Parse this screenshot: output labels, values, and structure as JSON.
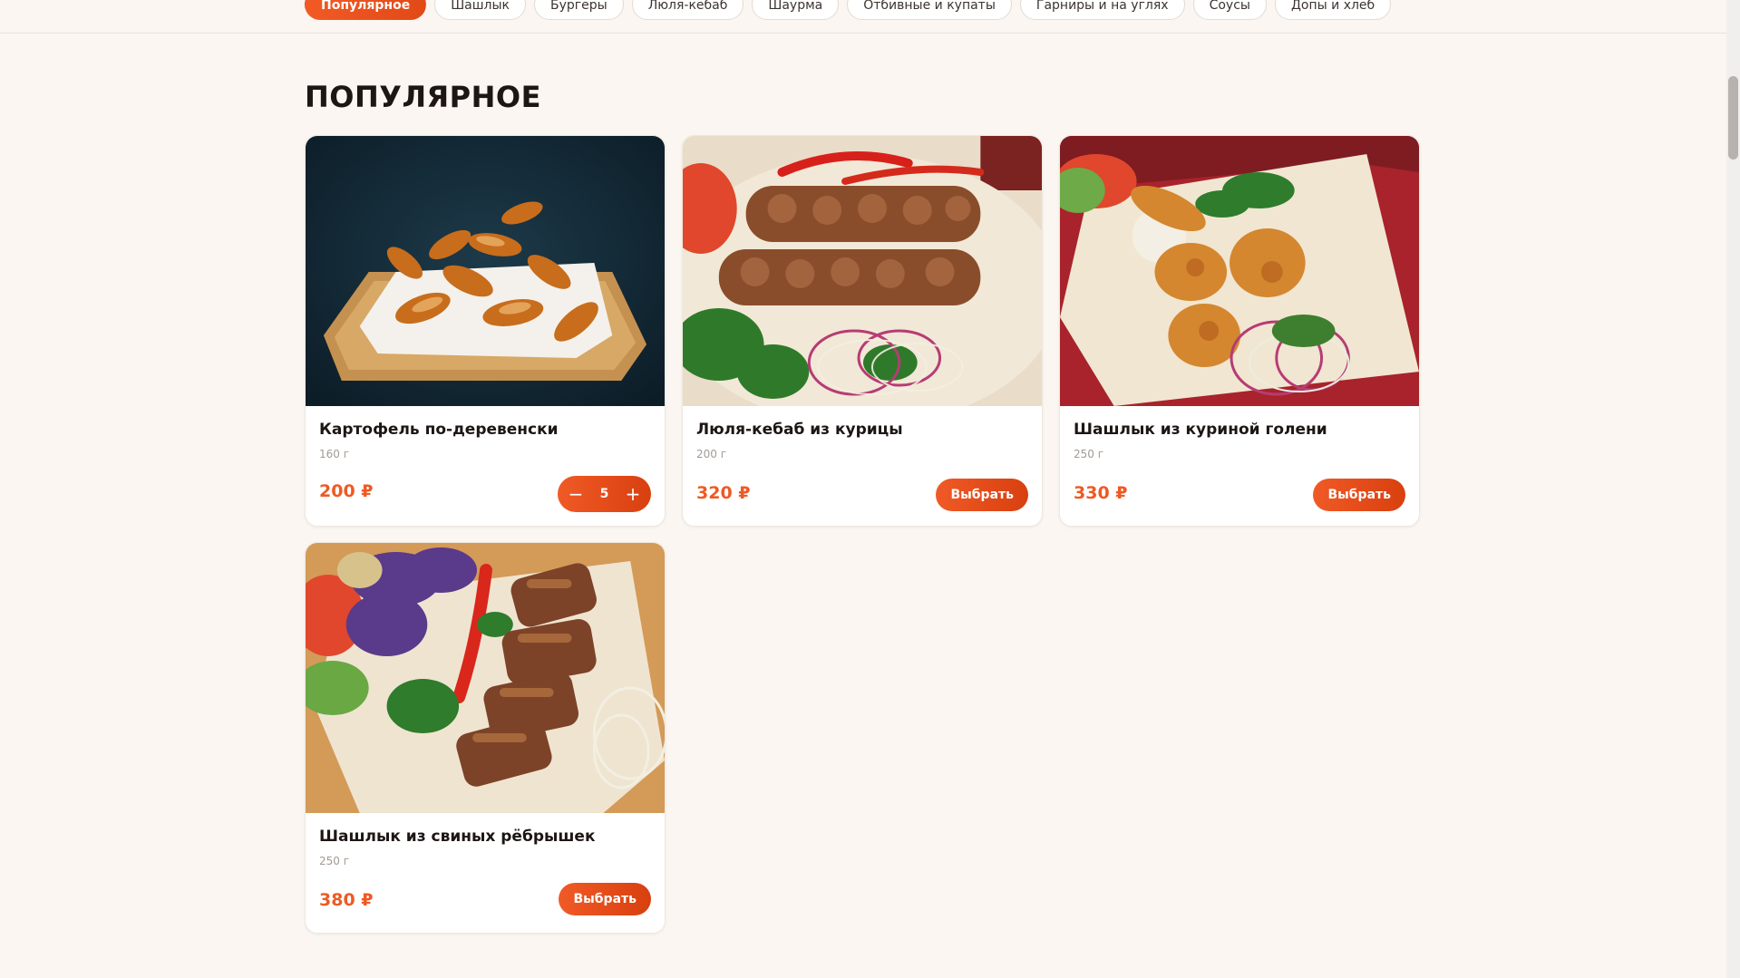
{
  "categories": [
    {
      "label": "Популярное",
      "active": true
    },
    {
      "label": "Шашлык",
      "active": false
    },
    {
      "label": "Бургеры",
      "active": false
    },
    {
      "label": "Люля-кебаб",
      "active": false
    },
    {
      "label": "Шаурма",
      "active": false
    },
    {
      "label": "Отбивные и купаты",
      "active": false
    },
    {
      "label": "Гарниры и на углях",
      "active": false
    },
    {
      "label": "Соусы",
      "active": false
    },
    {
      "label": "Допы и хлеб",
      "active": false
    }
  ],
  "section": {
    "title": "ПОПУЛЯРНОЕ"
  },
  "products": [
    {
      "name": "Картофель по-деревенски",
      "weight": "160 г",
      "price": "200 ₽",
      "quantity": "5",
      "image_icon": "potato-wedges-photo"
    },
    {
      "name": "Люля-кебаб из курицы",
      "weight": "200 г",
      "price": "320 ₽",
      "button_label": "Выбрать",
      "image_icon": "kebab-photo"
    },
    {
      "name": "Шашлык из куриной голени",
      "weight": "250 г",
      "price": "330 ₽",
      "button_label": "Выбрать",
      "image_icon": "chicken-drumsticks-photo"
    },
    {
      "name": "Шашлык из свиных рёбрышек",
      "weight": "250 г",
      "price": "380 ₽",
      "button_label": "Выбрать",
      "image_icon": "pork-ribs-photo"
    }
  ],
  "stepper": {
    "minus": "−",
    "plus": "+"
  },
  "colors": {
    "accent": "#ee5a24",
    "background": "#fbf6f1"
  }
}
